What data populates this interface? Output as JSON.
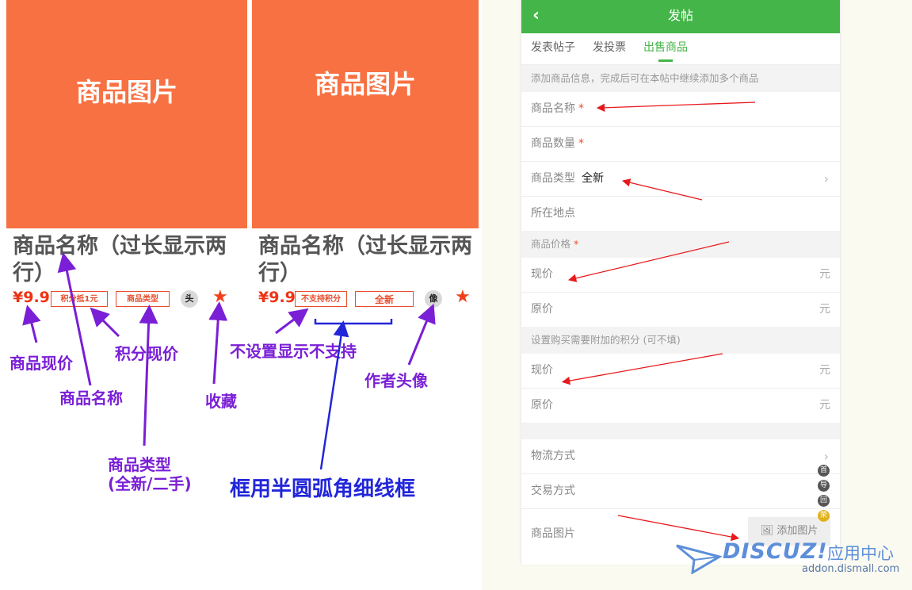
{
  "cards": [
    {
      "image_label": "商品图片",
      "name": "商品名称（过长显示两行）",
      "price": "¥9.9",
      "points_tag": "积分抵1元",
      "type_tag": "商品类型",
      "avatar": "头",
      "fav_icon": "star-icon"
    },
    {
      "image_label": "商品图片",
      "name": "商品名称（过长显示两行）",
      "price": "¥9.9",
      "points_tag": "不支持积分",
      "type_tag": "全新",
      "avatar": "像",
      "fav_icon": "star-icon"
    }
  ],
  "annotations": {
    "current_price": "商品现价",
    "points_price": "积分现价",
    "product_name": "商品名称",
    "favorite": "收藏",
    "product_type": "商品类型",
    "product_type_note": "(全新/二手)",
    "no_points": "不设置显示不支持",
    "author_avatar": "作者头像",
    "border_note": "框用半圆弧角细线框"
  },
  "phone": {
    "title": "发帖",
    "back_icon": "chevron-left-icon",
    "tabs": [
      {
        "label": "发表帖子",
        "active": false
      },
      {
        "label": "发投票",
        "active": false
      },
      {
        "label": "出售商品",
        "active": true
      }
    ],
    "notice": "添加商品信息，完成后可在本帖中继续添加多个商品",
    "fields": {
      "name": {
        "label": "商品名称",
        "required": "*"
      },
      "qty": {
        "label": "商品数量",
        "required": "*"
      },
      "type": {
        "label": "商品类型",
        "value": "全新",
        "chevron": "›"
      },
      "location": {
        "label": "所在地点"
      }
    },
    "price_section": {
      "label": "商品价格",
      "required": "*"
    },
    "price_rows": [
      {
        "label": "现价",
        "unit": "元"
      },
      {
        "label": "原价",
        "unit": "元"
      }
    ],
    "points_section": "设置购买需要附加的积分 (可不填)",
    "points_rows": [
      {
        "label": "现价",
        "unit": "元"
      },
      {
        "label": "原价",
        "unit": "元"
      }
    ],
    "logistics": {
      "label": "物流方式",
      "chevron": "›"
    },
    "trade": {
      "label": "交易方式"
    },
    "images": {
      "label": "商品图片",
      "button": "添加图片",
      "button_icon": "image-icon"
    },
    "side_icons": [
      "首",
      "导",
      "回",
      "荣"
    ]
  },
  "watermark": {
    "brand": "DISCUZ!",
    "cn": "应用中心",
    "domain": "addon.dismall.com"
  },
  "colors": {
    "product_image": "#f87142",
    "price": "#ee3314",
    "annotation": "#7a1fd6",
    "annotation_blue": "#2226d9",
    "header_green": "#44b549",
    "arrow_red": "#e8181b"
  }
}
